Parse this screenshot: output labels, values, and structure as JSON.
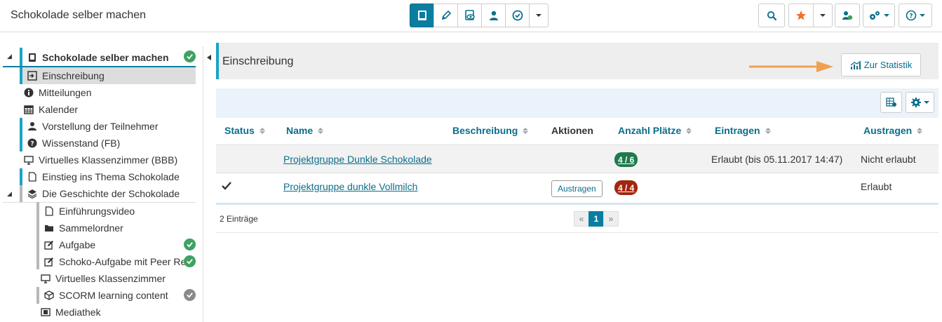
{
  "course": {
    "title": "Schokolade selber machen"
  },
  "toolbar": {
    "buttons": [
      {
        "icon": "book-icon",
        "active": true
      },
      {
        "icon": "pencil-icon"
      },
      {
        "icon": "eye-book-icon"
      },
      {
        "icon": "members-icon"
      },
      {
        "icon": "assessment-icon"
      }
    ],
    "right": [
      "search-icon",
      "star-icon",
      "user-status-icon",
      "gears-icon",
      "help-icon"
    ]
  },
  "sidebar": {
    "root": "Schokolade selber machen",
    "items": [
      {
        "label": "Einschreibung"
      },
      {
        "label": "Mitteilungen"
      },
      {
        "label": "Kalender"
      },
      {
        "label": "Vorstellung der Teilnehmer"
      },
      {
        "label": "Wissenstand (FB)"
      },
      {
        "label": "Virtuelles Klassenzimmer (BBB)"
      },
      {
        "label": "Einstieg ins Thema Schokolade"
      },
      {
        "label": "Die Geschichte der Schokolade"
      },
      {
        "label": "Einführungsvideo"
      },
      {
        "label": "Sammelordner"
      },
      {
        "label": "Aufgabe"
      },
      {
        "label": "Schoko-Aufgabe mit Peer Re"
      },
      {
        "label": "Virtuelles Klassenzimmer"
      },
      {
        "label": "SCORM learning content"
      },
      {
        "label": "Mediathek"
      }
    ]
  },
  "main": {
    "title": "Einschreibung",
    "stat_button": "Zur Statistik",
    "columns": {
      "status": "Status",
      "name": "Name",
      "beschreibung": "Beschreibung",
      "aktionen": "Aktionen",
      "plaetze": "Anzahl Plätze",
      "eintragen": "Eintragen",
      "austragen": "Austragen"
    },
    "rows": [
      {
        "name": "Projektgruppe Dunkle Schokolade",
        "plaetze": "4 / 6",
        "eintragen": "Erlaubt (bis 05.11.2017 14:47)",
        "austragen": "Nicht erlaubt"
      },
      {
        "name": "Projektgruppe dunkle Vollmilch",
        "action": "Austragen",
        "plaetze": "4 / 4",
        "eintragen": "",
        "austragen": "Erlaubt"
      }
    ],
    "entries": "2 Einträge",
    "pager": {
      "prev": "«",
      "current": "1",
      "next": "»"
    }
  },
  "colors": {
    "accent": "#0a7ea0",
    "green": "#1e7a4e",
    "red": "#a2260f",
    "arrow": "#f0a050"
  }
}
